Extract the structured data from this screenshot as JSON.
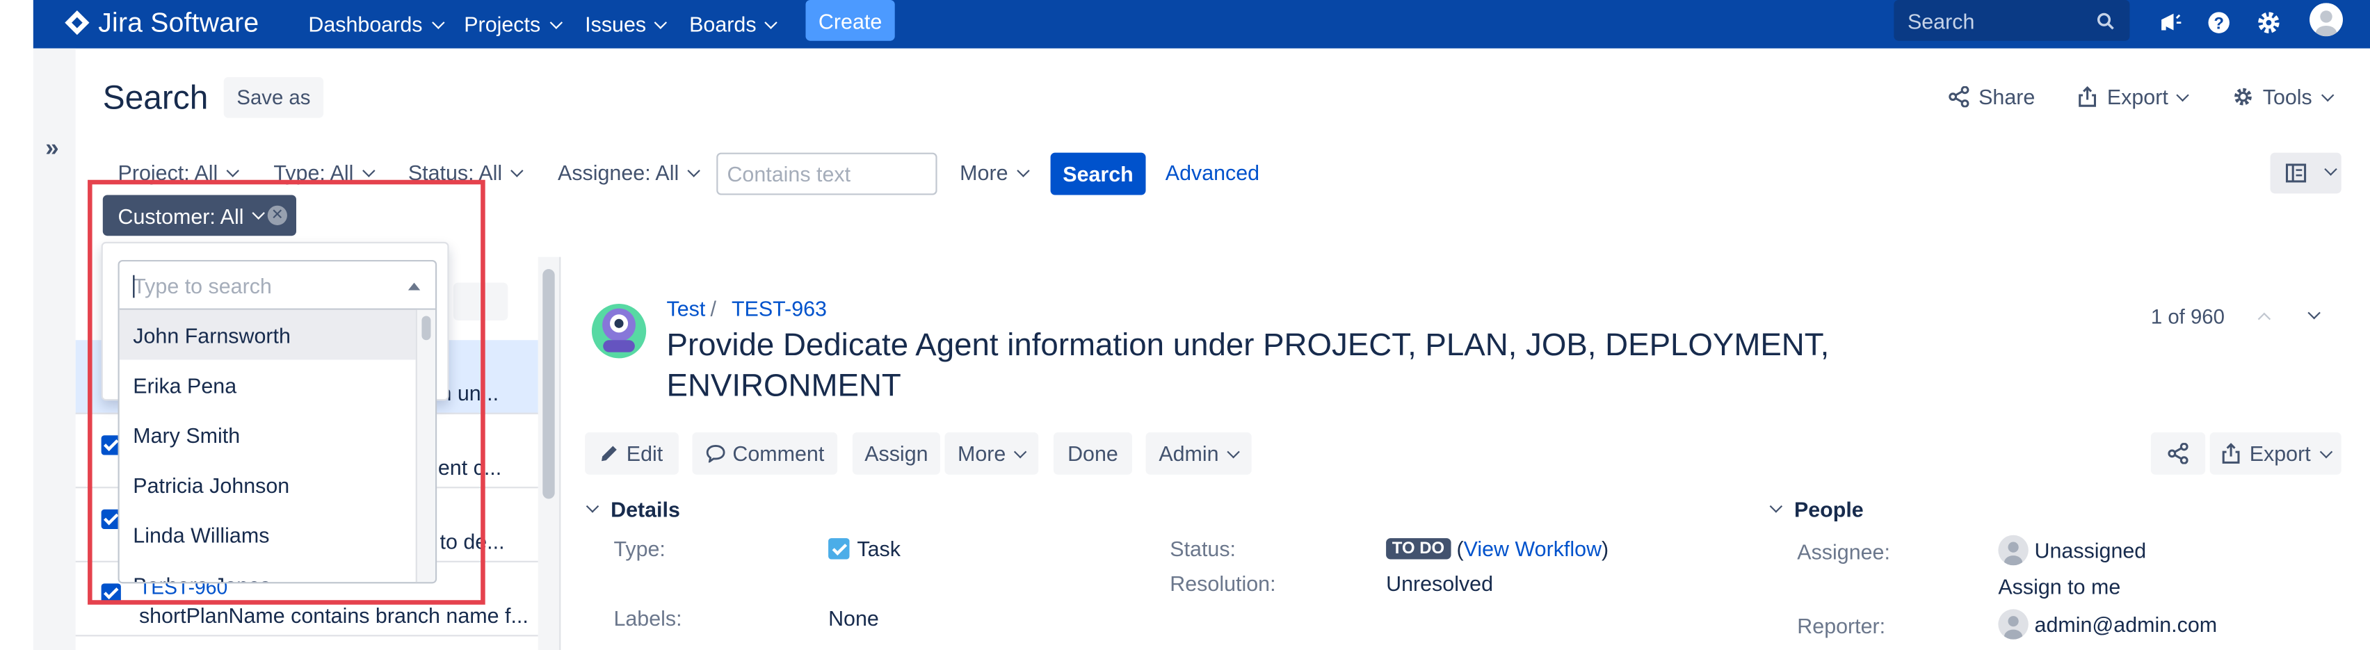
{
  "nav": {
    "brand": "Jira Software",
    "items": [
      "Dashboards",
      "Projects",
      "Issues",
      "Boards"
    ],
    "create": "Create",
    "search_placeholder": "Search"
  },
  "header": {
    "title": "Search",
    "save_as": "Save as",
    "share": "Share",
    "export": "Export",
    "tools": "Tools"
  },
  "filters": {
    "project": "Project: All",
    "type": "Type: All",
    "status": "Status: All",
    "assignee": "Assignee: All",
    "text_placeholder": "Contains text",
    "more": "More",
    "search": "Search",
    "advanced": "Advanced",
    "customer": "Customer: All"
  },
  "dropdown": {
    "placeholder": "Type to search",
    "options": [
      "John Farnsworth",
      "Erika Pena",
      "Mary Smith",
      "Patricia Johnson",
      "Linda Williams",
      "Barbara Jones"
    ]
  },
  "list": {
    "rows": [
      {
        "key": "",
        "summary": "n un..."
      },
      {
        "key": "",
        "summary": "gent c..."
      },
      {
        "key": "",
        "summary": "to de..."
      },
      {
        "key": "TEST-960",
        "summary": "shortPlanName contains branch name f..."
      }
    ]
  },
  "issue": {
    "project": "Test",
    "sep": "/",
    "key": "TEST-963",
    "title": "Provide Dedicate Agent information under PROJECT, PLAN, JOB, DEPLOYMENT, ENVIRONMENT",
    "pager": "1 of 960",
    "actions": {
      "edit": "Edit",
      "comment": "Comment",
      "assign": "Assign",
      "more": "More",
      "done": "Done",
      "admin": "Admin",
      "export": "Export"
    },
    "details": {
      "heading": "Details",
      "type_label": "Type:",
      "type_value": "Task",
      "status_label": "Status:",
      "status_value": "TO DO",
      "workflow_open": "(",
      "workflow_link": "View Workflow",
      "workflow_close": ")",
      "resolution_label": "Resolution:",
      "resolution_value": "Unresolved",
      "labels_label": "Labels:",
      "labels_value": "None"
    },
    "people": {
      "heading": "People",
      "assignee_label": "Assignee:",
      "assignee_value": "Unassigned",
      "assign_to_me": "Assign to me",
      "reporter_label": "Reporter:",
      "reporter_value": "admin@admin.com"
    }
  },
  "colors": {
    "nav": "#0747a6",
    "primary": "#0052cc",
    "create": "#4c9aff",
    "highlight": "#e5424d"
  }
}
